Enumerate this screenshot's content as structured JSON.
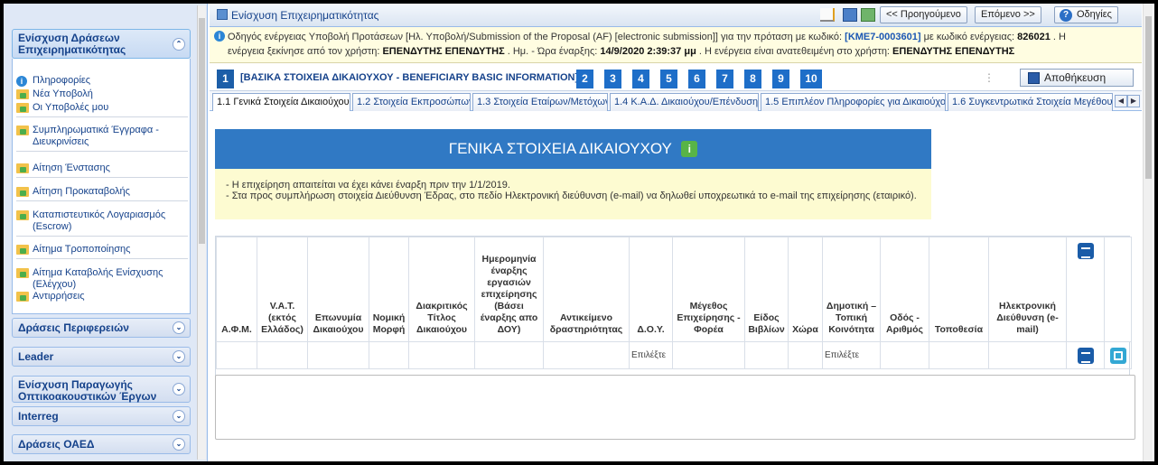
{
  "sidebar": {
    "groups": [
      {
        "label": "Ενίσχυση Δράσεων Επιχειρηματικότητας",
        "open": true
      },
      {
        "label": "Δράσεις Περιφερειών"
      },
      {
        "label": "Leader"
      },
      {
        "label": "Ενίσχυση Παραγωγής Οπτικοακουστικών Έργων"
      },
      {
        "label": "Interreg"
      },
      {
        "label": "Δράσεις ΟΑΕΔ"
      }
    ],
    "items": [
      {
        "label": "Πληροφορίες",
        "icon": "info-icon"
      },
      {
        "label": "Νέα Υποβολή",
        "icon": "folder-icon"
      },
      {
        "label": "Οι Υποβολές μου",
        "icon": "folder-icon"
      },
      {
        "label": "Συμπληρωματικά Έγγραφα - Διευκρινίσεις",
        "icon": "folder-icon"
      },
      {
        "label": "Αίτηση Ένστασης",
        "icon": "folder-icon"
      },
      {
        "label": "Αίτηση Προκαταβολής",
        "icon": "folder-icon"
      },
      {
        "label": "Καταπιστευτικός Λογαριασμός (Escrow)",
        "icon": "folder-icon"
      },
      {
        "label": "Αίτημα Τροποποίησης",
        "icon": "folder-icon"
      },
      {
        "label": "Αίτημα Καταβολής Ενίσχυσης (Ελέγχου)",
        "icon": "folder-icon"
      },
      {
        "label": "Αντιρρήσεις",
        "icon": "folder-icon"
      }
    ]
  },
  "titlebar": {
    "title": "Ενίσχυση Επιχειρηματικότητας",
    "prev_label": "<< Προηγούμενο",
    "next_label": "Επόμενο >>",
    "help_label": "Οδηγίες"
  },
  "notice": {
    "t1": "Οδηγός ενέργειας Υποβολή Προτάσεων [Ηλ. Υποβολή/Submission of the Proposal (AF) [electronic submission]] για την πρόταση με κωδικό: ",
    "code": "[ΚΜΕ7-0003601]",
    "t2": " με κωδικό ενέργειας: ",
    "action_code": "826021",
    "t3": " . Η",
    "t4": "ενέργεια ξεκίνησε από τον χρήστη: ",
    "user": "ΕΠΕΝΔΥΤΗΣ ΕΠΕΝΔΥΤΗΣ",
    "t5": " . Ημ. - Ώρα έναρξης: ",
    "start": "14/9/2020 2:39:37 μμ",
    "t6": " . Η ενέργεια είναι ανατεθειμένη στο χρήστη: ",
    "assignee": "ΕΠΕΝΔΥΤΗΣ ΕΠΕΝΔΥΤΗΣ"
  },
  "steps": {
    "numbers": [
      "1",
      "2",
      "3",
      "4",
      "5",
      "6",
      "7",
      "8",
      "9",
      "10"
    ],
    "active_label": "[ΒΑΣΙΚΑ ΣΤΟΙΧΕΙΑ ΔΙΚΑΙΟΥΧΟΥ - BENEFICIARY BASIC INFORMATION]",
    "save_label": "Αποθήκευση"
  },
  "tabs": [
    "1.1 Γενικά Στοιχεία Δικαιούχου",
    "1.2 Στοιχεία Εκπροσώπων",
    "1.3 Στοιχεία Εταίρων/Μετόχων",
    "1.4 Κ.Α.Δ. Δικαιούχου/Επένδυσης",
    "1.5 Επιπλέον Πληροφορίες για Δικαιούχο",
    "1.6 Συγκεντρωτικά Στοιχεία Μεγέθου"
  ],
  "section": {
    "title": "ΓΕΝΙΚΑ ΣΤΟΙΧΕΙΑ ΔΙΚΑΙΟΥΧΟΥ",
    "note1": "- Η επιχείρηση απαιτείται να έχει κάνει έναρξη πριν την 1/1/2019.",
    "note2": "- Στα προς συμπλήρωση στοιχεία Διεύθυνση Έδρας, στο πεδίο Ηλεκτρονική διεύθυνση (e-mail) να δηλωθεί υποχρεωτικά το e-mail της επιχείρησης (εταιρικό)."
  },
  "grid": {
    "columns": [
      "Α.Φ.Μ.",
      "V.A.T. (εκτός Ελλάδος)",
      "Επωνυμία Δικαιούχου",
      "Νομική Μορφή",
      "Διακριτικός Τίτλος Δικαιούχου",
      "Ημερομηνία έναρξης εργασιών επιχείρησης (Βάσει έναρξης απο ΔΟΥ)",
      "Αντικείμενο δραστηριότητας",
      "Δ.Ο.Υ.",
      "Μέγεθος Επιχείρησης - Φορέα",
      "Είδος Βιβλίων",
      "Χώρα",
      "Δημοτική – Τοπική Κοινότητα",
      "Οδός - Αριθμός",
      "Τοποθεσία",
      "Ηλεκτρονική Διεύθυνση (e-mail)"
    ],
    "select_placeholder": "Επιλέξτε"
  }
}
